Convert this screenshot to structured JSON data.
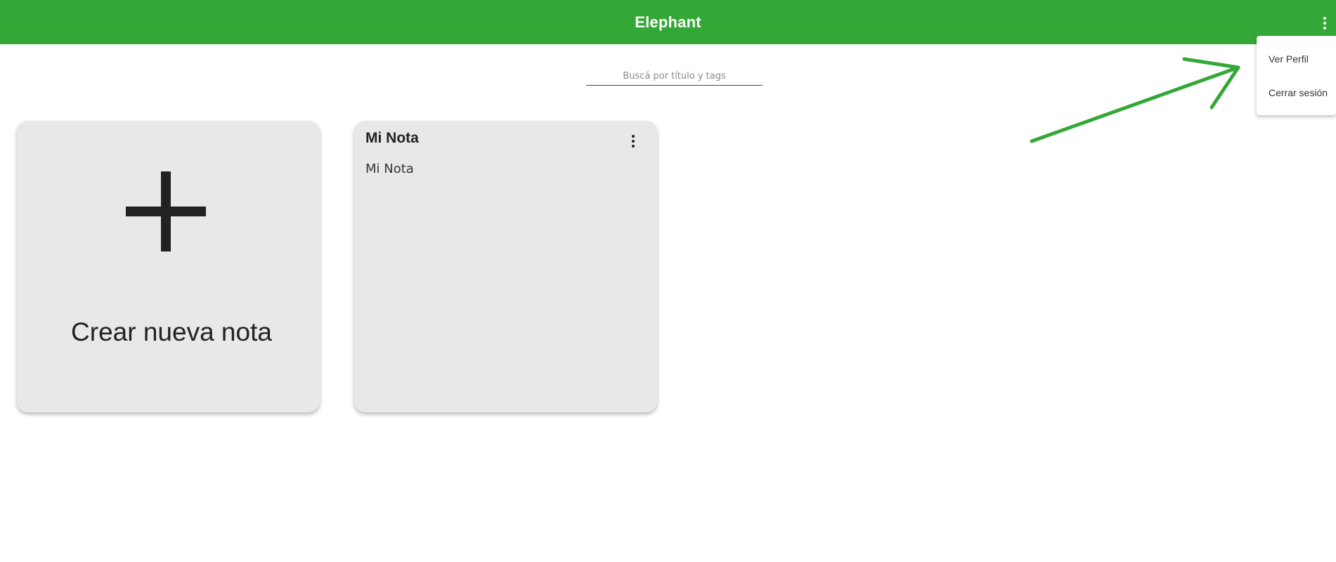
{
  "header": {
    "title": "Elephant",
    "menu_icon": "more-vert-icon",
    "background_color": "#34a836"
  },
  "dropdown": {
    "items": [
      {
        "label": "Ver Perfil"
      },
      {
        "label": "Cerrar sesión"
      }
    ]
  },
  "search": {
    "placeholder": "Buscá por título y tags",
    "value": ""
  },
  "create_card": {
    "icon": "plus-icon",
    "label": "Crear nueva nota"
  },
  "notes": [
    {
      "title": "Mi Nota",
      "body": "Mi Nota",
      "menu_icon": "more-vert-icon"
    }
  ],
  "annotation": {
    "icon": "arrow-icon",
    "color": "#34a836"
  }
}
